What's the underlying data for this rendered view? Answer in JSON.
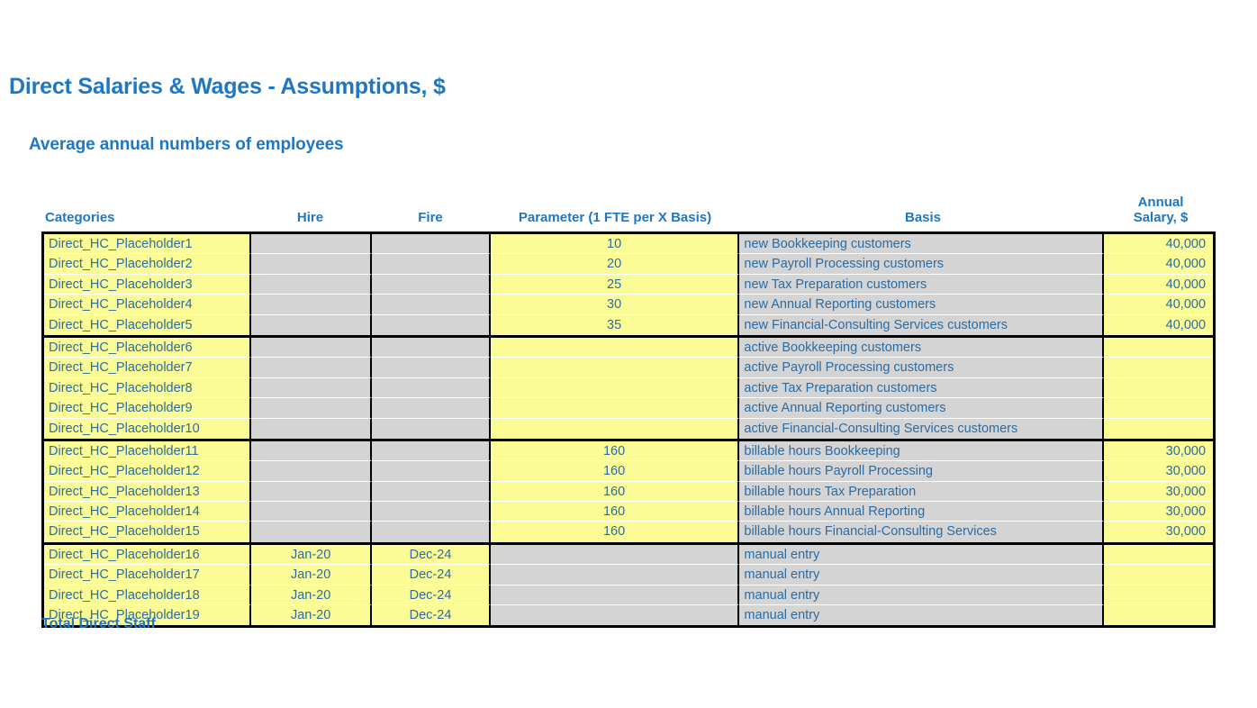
{
  "page": {
    "main_title": "Direct Salaries & Wages - Assumptions, $",
    "sub_title": "Average annual numbers of employees",
    "total_label": "Total Direct Staff",
    "accent_color": "#1F77C4",
    "input_cell_color": "#FCFC96",
    "formula_cell_color": "#D4D4D4"
  },
  "table": {
    "headers": {
      "categories": "Categories",
      "hire": "Hire",
      "fire": "Fire",
      "parameter": "Parameter (1 FTE per X Basis)",
      "basis": "Basis",
      "annual_salary": "Annual\nSalary, $"
    },
    "annual_salary_line1": "Annual",
    "annual_salary_line2": "Salary, $",
    "groups": [
      {
        "name": "new-customers-group",
        "rows": [
          {
            "category": "Direct_HC_Placeholder1",
            "hire": "",
            "fire": "",
            "parameter": "10",
            "basis": "new Bookkeeping customers",
            "salary": "40,000"
          },
          {
            "category": "Direct_HC_Placeholder2",
            "hire": "",
            "fire": "",
            "parameter": "20",
            "basis": "new Payroll Processing customers",
            "salary": "40,000"
          },
          {
            "category": "Direct_HC_Placeholder3",
            "hire": "",
            "fire": "",
            "parameter": "25",
            "basis": "new Tax Preparation customers",
            "salary": "40,000"
          },
          {
            "category": "Direct_HC_Placeholder4",
            "hire": "",
            "fire": "",
            "parameter": "30",
            "basis": "new Annual Reporting customers",
            "salary": "40,000"
          },
          {
            "category": "Direct_HC_Placeholder5",
            "hire": "",
            "fire": "",
            "parameter": "35",
            "basis": "new Financial-Consulting Services customers",
            "salary": "40,000"
          }
        ]
      },
      {
        "name": "active-customers-group",
        "rows": [
          {
            "category": "Direct_HC_Placeholder6",
            "hire": "",
            "fire": "",
            "parameter": "",
            "basis": "active Bookkeeping customers",
            "salary": ""
          },
          {
            "category": "Direct_HC_Placeholder7",
            "hire": "",
            "fire": "",
            "parameter": "",
            "basis": "active Payroll Processing customers",
            "salary": ""
          },
          {
            "category": "Direct_HC_Placeholder8",
            "hire": "",
            "fire": "",
            "parameter": "",
            "basis": "active Tax Preparation customers",
            "salary": ""
          },
          {
            "category": "Direct_HC_Placeholder9",
            "hire": "",
            "fire": "",
            "parameter": "",
            "basis": "active Annual Reporting customers",
            "salary": ""
          },
          {
            "category": "Direct_HC_Placeholder10",
            "hire": "",
            "fire": "",
            "parameter": "",
            "basis": "active Financial-Consulting Services customers",
            "salary": ""
          }
        ]
      },
      {
        "name": "billable-hours-group",
        "rows": [
          {
            "category": "Direct_HC_Placeholder11",
            "hire": "",
            "fire": "",
            "parameter": "160",
            "basis": "billable hours Bookkeeping",
            "salary": "30,000"
          },
          {
            "category": "Direct_HC_Placeholder12",
            "hire": "",
            "fire": "",
            "parameter": "160",
            "basis": "billable hours Payroll Processing",
            "salary": "30,000"
          },
          {
            "category": "Direct_HC_Placeholder13",
            "hire": "",
            "fire": "",
            "parameter": "160",
            "basis": "billable hours Tax Preparation",
            "salary": "30,000"
          },
          {
            "category": "Direct_HC_Placeholder14",
            "hire": "",
            "fire": "",
            "parameter": "160",
            "basis": "billable hours Annual Reporting",
            "salary": "30,000"
          },
          {
            "category": "Direct_HC_Placeholder15",
            "hire": "",
            "fire": "",
            "parameter": "160",
            "basis": "billable hours Financial-Consulting Services",
            "salary": "30,000"
          }
        ]
      },
      {
        "name": "manual-entry-group",
        "rows": [
          {
            "category": "Direct_HC_Placeholder16",
            "hire": "Jan-20",
            "fire": "Dec-24",
            "parameter": "",
            "basis": "manual entry",
            "salary": ""
          },
          {
            "category": "Direct_HC_Placeholder17",
            "hire": "Jan-20",
            "fire": "Dec-24",
            "parameter": "",
            "basis": "manual entry",
            "salary": ""
          },
          {
            "category": "Direct_HC_Placeholder18",
            "hire": "Jan-20",
            "fire": "Dec-24",
            "parameter": "",
            "basis": "manual entry",
            "salary": ""
          },
          {
            "category": "Direct_HC_Placeholder19",
            "hire": "Jan-20",
            "fire": "Dec-24",
            "parameter": "",
            "basis": "manual entry",
            "salary": ""
          }
        ]
      }
    ]
  }
}
